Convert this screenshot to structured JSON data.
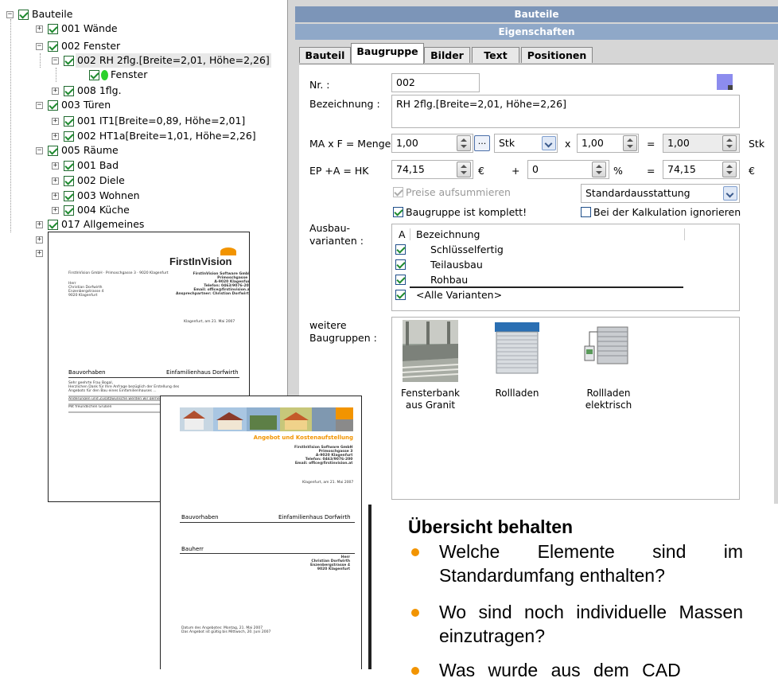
{
  "tree": {
    "items": [
      {
        "label": "Bauteile"
      },
      {
        "label": "001 Wände"
      },
      {
        "label": "002 Fenster"
      },
      {
        "label": "002 RH 2flg.[Breite=2,01, Höhe=2,26]"
      },
      {
        "label": "Fenster"
      },
      {
        "label": "008 1flg."
      },
      {
        "label": "003 Türen"
      },
      {
        "label": "001 IT1[Breite=0,89, Höhe=2,01]"
      },
      {
        "label": "002 HT1a[Breite=1,01, Höhe=2,26]"
      },
      {
        "label": "005 Räume"
      },
      {
        "label": "001 Bad"
      },
      {
        "label": "002 Diele"
      },
      {
        "label": "003 Wohnen"
      },
      {
        "label": "004 Küche"
      },
      {
        "label": "017 Allgemeines"
      }
    ]
  },
  "dialog": {
    "title": "Bauteile",
    "subtitle": "Eigenschaften",
    "tabs": [
      "Bauteil",
      "Baugruppe",
      "Bilder",
      "Text",
      "Positionen"
    ],
    "active_tab": "Baugruppe",
    "nr_label": "Nr. :",
    "nr_value": "002",
    "bez_label": "Bezeichnung :",
    "bez_value": "RH 2flg.[Breite=2,01, Höhe=2,26]",
    "ma_label": "MA x F = Menge",
    "ma_value": "1,00",
    "ellipsis": "...",
    "unit_value": "Stk",
    "times": "x",
    "factor_value": "1,00",
    "eq1": "=",
    "menge_value": "1,00",
    "menge_unit": "Stk",
    "ep_label": "EP +A = HK",
    "ep_value": "74,15",
    "euro1": "€",
    "plus": "+",
    "aufschlag_value": "0",
    "percent": "%",
    "eq2": "=",
    "hk_value": "74,15",
    "euro2": "€",
    "preise_label": "Preise aufsummieren",
    "ausstattung_value": "Standardausstattung",
    "komplett_label": "Baugruppe ist komplett!",
    "ignorieren_label": "Bei der Kalkulation ignorieren",
    "ausbau_label": "Ausbau-\nvarianten :",
    "table_headers": [
      "A",
      "Bezeichnung"
    ],
    "varianten": [
      "Schlüsselfertig",
      "Teilausbau",
      "Rohbau",
      "<Alle Varianten>"
    ],
    "weitere_label": "weitere\nBaugruppen :",
    "baugruppen": [
      "Fensterbank aus Granit",
      "Rollladen",
      "Rollladen elektrisch"
    ]
  },
  "doc1": {
    "logo": "FirstInVision",
    "sender_line": "FirstInVision GmbH · Primoschgasse 3 · 9020 Klagenfurt",
    "address": "Herr\nChristian Dorfwirth\nEnzenbergstrasse 4\n9020 Klagenfurt",
    "company": "FirstInVision Software GmbH\nPrimoschgasse 3\nA-9020 Klagenfurt\nTelefon: 0463/9076-200\nEmail: office@firstinvision.at\nAnsprechpartner: Christian Dorfwirth",
    "date": "Klagenfurt, am 21. Mai 2007",
    "project_label": "Bauvorhaben",
    "project_value": "Einfamilienhaus Dorfwirth",
    "body": "Sehr geehrte Frau Bogal,\nHerzlichen Dank für Ihre Anfrage bezüglich der Erstellung des\nAngebots für den Bau eines Einfamilienhauses ...\n\nAnderungen und Zusatzwünsche werden wir gerne berücksichtigen ...\n\nMit freundlichen Grüßen"
  },
  "doc2": {
    "title": "Angebot und Kostenaufstellung",
    "company": "FirstInVision Software GmbH\nPrimoschgasse 3\nA-9020 Klagenfurt\nTelefon: 0463/9076-200\nEmail: office@firstinvision.at",
    "date": "Klagenfurt, am 21. Mai 2007",
    "project_label": "Bauvorhaben",
    "project_value": "Einfamilienhaus Dorfwirth",
    "bauherr_label": "Bauherr",
    "bauherr_value": "Herr\nChristian Dorfwirth\nEnzenbergstrasse 4\n9020 Klagenfurt",
    "footer": "Datum des Angebotes: Montag, 21. Mai 2007\nDas Angebot ist gültig bis Mittwoch, 20. Juni 2007"
  },
  "text": {
    "heading": "Übersicht behalten",
    "bullets": [
      "Welche Elemente sind im Standardumfang enthalten?",
      "Wo sind noch individuelle Massen einzutragen?",
      "Was wurde aus dem CAD"
    ]
  },
  "colors": {
    "accent_orange": "#f29400",
    "title_bar": "#7c95b8",
    "check_green": "#1d8a2e"
  }
}
